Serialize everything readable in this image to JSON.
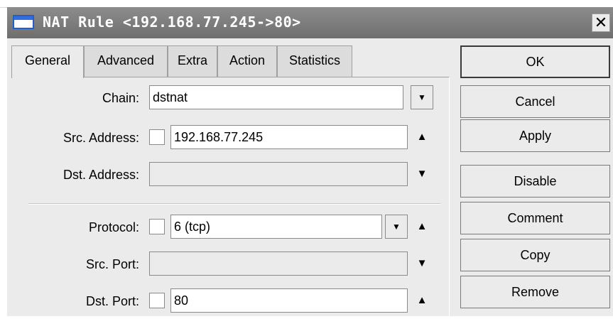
{
  "window": {
    "title": "NAT Rule <192.168.77.245->80>",
    "close_glyph": "✕"
  },
  "tabs": [
    {
      "label": "General",
      "active": true
    },
    {
      "label": "Advanced",
      "active": false
    },
    {
      "label": "Extra",
      "active": false
    },
    {
      "label": "Action",
      "active": false
    },
    {
      "label": "Statistics",
      "active": false
    }
  ],
  "form": {
    "chain": {
      "label": "Chain:",
      "value": "dstnat"
    },
    "src_address": {
      "label": "Src. Address:",
      "value": "192.168.77.245",
      "negate": false
    },
    "dst_address": {
      "label": "Dst. Address:",
      "value": ""
    },
    "protocol": {
      "label": "Protocol:",
      "value": "6 (tcp)",
      "negate": false
    },
    "src_port": {
      "label": "Src. Port:",
      "value": ""
    },
    "dst_port": {
      "label": "Dst. Port:",
      "value": "80",
      "negate": false
    }
  },
  "glyphs": {
    "dropdown": "▼",
    "arrow_up": "▲",
    "arrow_down": "▼"
  },
  "buttons": {
    "ok": "OK",
    "cancel": "Cancel",
    "apply": "Apply",
    "disable": "Disable",
    "comment": "Comment",
    "copy": "Copy",
    "remove": "Remove"
  },
  "colors": {
    "titlebar": "#7a7a7a",
    "window_bg": "#ebebeb",
    "icon_blue": "#2f6fe0"
  }
}
